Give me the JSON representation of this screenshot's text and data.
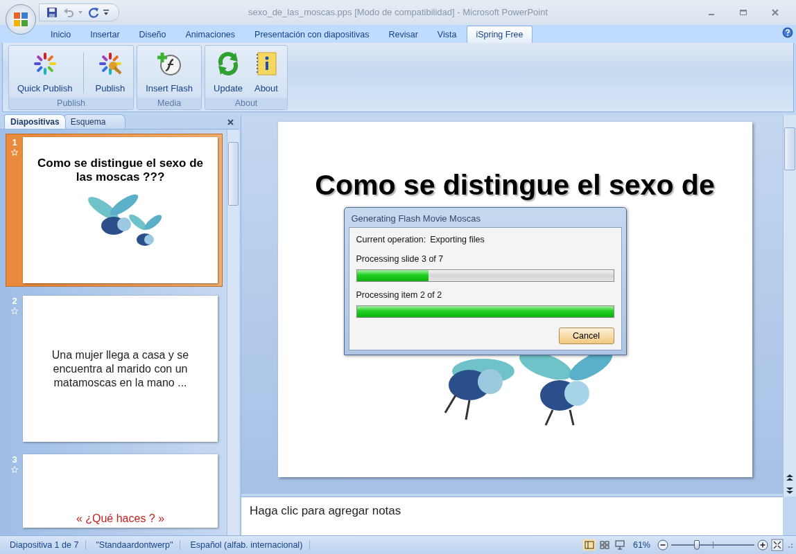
{
  "window": {
    "title": "sexo_de_las_moscas.pps [Modo de compatibilidad] - Microsoft PowerPoint"
  },
  "tabs": [
    {
      "label": "Inicio",
      "selected": false
    },
    {
      "label": "Insertar",
      "selected": false
    },
    {
      "label": "Diseño",
      "selected": false
    },
    {
      "label": "Animaciones",
      "selected": false
    },
    {
      "label": "Presentación con diapositivas",
      "selected": false
    },
    {
      "label": "Revisar",
      "selected": false
    },
    {
      "label": "Vista",
      "selected": false
    },
    {
      "label": "iSpring Free",
      "selected": true
    }
  ],
  "ribbon": {
    "groups": [
      {
        "label": "Publish",
        "buttons": [
          {
            "label": "Quick Publish",
            "kind": "quick"
          },
          {
            "label": "Publish",
            "kind": "publish"
          }
        ]
      },
      {
        "label": "Media",
        "buttons": [
          {
            "label": "Insert Flash",
            "kind": "flash"
          }
        ]
      },
      {
        "label": "About",
        "buttons": [
          {
            "label": "Update",
            "kind": "update"
          },
          {
            "label": "About",
            "kind": "about"
          }
        ]
      }
    ]
  },
  "pane_tabs": [
    {
      "label": "Diapositivas",
      "selected": true
    },
    {
      "label": "Esquema",
      "selected": false
    }
  ],
  "slides": [
    {
      "number": "1",
      "selected": true,
      "kind": "title",
      "text": "Como se distingue el sexo de las moscas ???"
    },
    {
      "number": "2",
      "selected": false,
      "kind": "text",
      "text": "Una mujer llega a casa y se encuentra al marido con un matamoscas en la mano ..."
    },
    {
      "number": "3",
      "selected": false,
      "kind": "quote",
      "text": "« ¿Qué haces ? »"
    }
  ],
  "current_slide": {
    "title": "Como se distingue el sexo de"
  },
  "dialog": {
    "title": "Generating Flash Movie Moscas",
    "operation_label": "Current operation:",
    "operation": "Exporting files",
    "progress": [
      {
        "label": "Processing slide 3 of 7",
        "level": 0.28
      },
      {
        "label": "Processing item 2 of 2",
        "level": 1
      }
    ],
    "button": "Cancel"
  },
  "notes": {
    "placeholder": "Haga clic para agregar notas"
  },
  "status_bar": {
    "items": [
      "Diapositiva 1 de 7",
      "\"Standaardontwerp\"",
      "Español (alfab. internacional)"
    ],
    "zoom": "61%",
    "zoom_slider": {
      "level": 0.31
    }
  }
}
